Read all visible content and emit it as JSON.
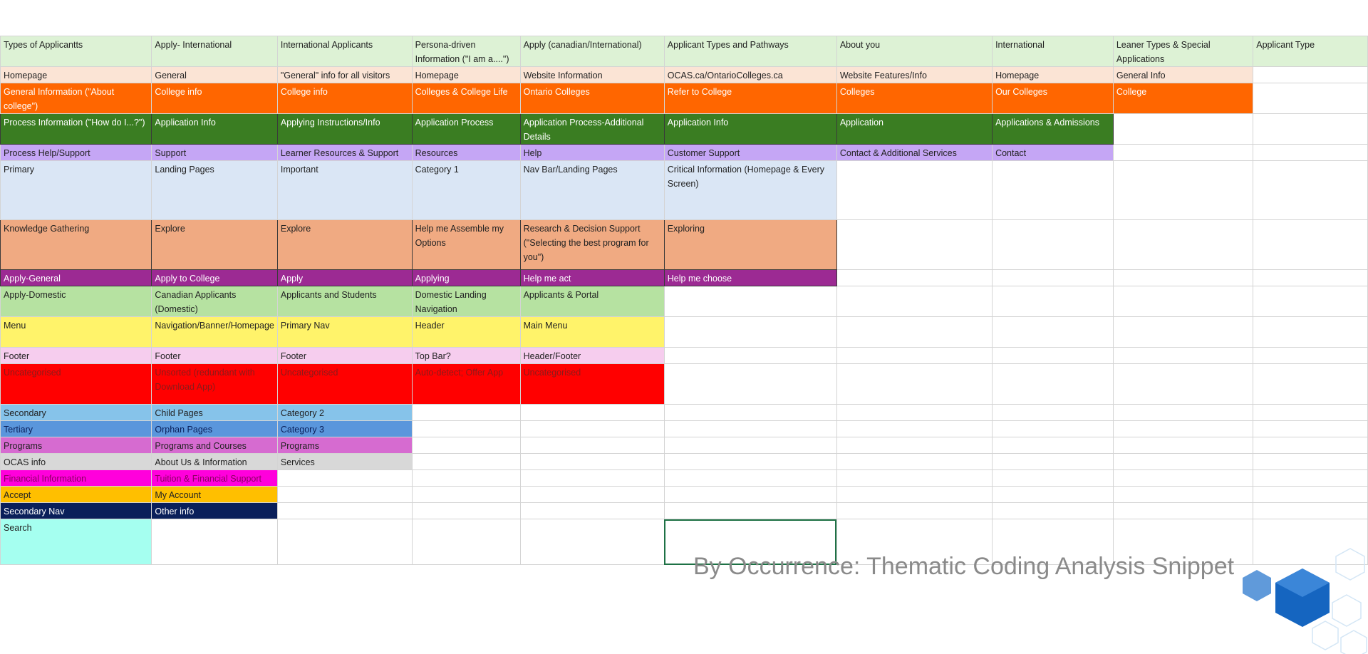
{
  "caption": "By Occurrence: Thematic Coding Analysis Snippet",
  "colors": {
    "pale_green": "#e2efda",
    "peach_light": "#fbe4d5",
    "orange": "#ff6600",
    "dark_green": "#3a7d22",
    "lavender": "#c5a6f5",
    "light_blue": "#dae6f5",
    "salmon": "#f0aa82",
    "purple": "#9c2a93",
    "green": "#b6e2a1",
    "yellow": "#fff36a",
    "pink": "#f6cdee",
    "red": "#ff0000",
    "sky_blue": "#86c3ea",
    "blue": "#5a96dc",
    "orchid": "#d66bd0",
    "gray": "#d8d8d8",
    "magenta": "#ff00dc",
    "amber": "#ffbf00",
    "navy": "#0a1f5a",
    "aqua": "#a5fff0",
    "header_row": "#ddf2d5"
  },
  "rows": [
    {
      "cells": [
        "Types of Applicantts",
        "Apply- International",
        "International Applicants",
        "Persona-driven Information (\"I am a....\")",
        "Apply (canadian/International)",
        "Applicant Types and Pathways",
        "About you",
        "International",
        "Leaner Types & Special Applications",
        "Applicant Type"
      ]
    },
    {
      "cells": [
        "Homepage",
        "General",
        "\"General\" info for all visitors",
        "Homepage",
        "Website Information",
        "OCAS.ca/OntarioColleges.ca",
        "Website Features/Info",
        "Homepage",
        "General Info"
      ]
    },
    {
      "cells": [
        "General Information (\"About college\")",
        "College info",
        "College info",
        "Colleges & College Life",
        "Ontario Colleges",
        "Refer to College",
        "Colleges",
        "Our Colleges",
        "College"
      ]
    },
    {
      "cells": [
        "Process Information (\"How do I...?\")",
        "Application Info",
        "Applying Instructions/Info",
        "Application Process",
        "Application Process-Additional Details",
        "Application Info",
        "Application",
        "Applications & Admissions"
      ]
    },
    {
      "cells": [
        "Process Help/Support",
        "Support",
        "Learner Resources & Support",
        "Resources",
        "Help",
        "Customer Support",
        "Contact & Additional Services",
        "Contact"
      ]
    },
    {
      "cells": [
        "Primary",
        "Landing Pages",
        "Important",
        "Category 1",
        "Nav Bar/Landing Pages",
        "Critical Information (Homepage & Every Screen)"
      ]
    },
    {
      "cells": [
        "Knowledge Gathering",
        "Explore",
        "Explore",
        "Help me Assemble my Options",
        "Research & Decision Support (\"Selecting the best program for you\")",
        "Exploring"
      ]
    },
    {
      "cells": [
        "Apply-General",
        "Apply to College",
        "Apply",
        "Applying",
        "Help me act",
        "Help me choose"
      ]
    },
    {
      "cells": [
        "Apply-Domestic",
        "Canadian Applicants (Domestic)",
        "Applicants and Students",
        "Domestic Landing Navigation",
        "Applicants & Portal"
      ]
    },
    {
      "cells": [
        "Menu",
        "Navigation/Banner/Homepage",
        "Primary Nav",
        "Header",
        "Main Menu"
      ]
    },
    {
      "cells": [
        "Footer",
        "Footer",
        "Footer",
        "Top Bar?",
        "Header/Footer"
      ]
    },
    {
      "cells": [
        "Uncategorised",
        "Unsorted (redundant with Download App)",
        "Uncategorised",
        "Auto-detect; Offer App",
        "Uncategorised"
      ]
    },
    {
      "cells": [
        "Secondary",
        "Child Pages",
        "Category 2"
      ]
    },
    {
      "cells": [
        "Tertiary",
        "Orphan Pages",
        "Category 3"
      ]
    },
    {
      "cells": [
        "Programs",
        "Programs and Courses",
        "Programs"
      ]
    },
    {
      "cells": [
        "OCAS info",
        "About Us & Information",
        "Services"
      ]
    },
    {
      "cells": [
        "Financial Information",
        "Tuition & Financial Support"
      ]
    },
    {
      "cells": [
        "Accept",
        "My Account"
      ]
    },
    {
      "cells": [
        "Secondary Nav",
        "Other info"
      ]
    },
    {
      "cells": [
        "Search"
      ]
    }
  ]
}
